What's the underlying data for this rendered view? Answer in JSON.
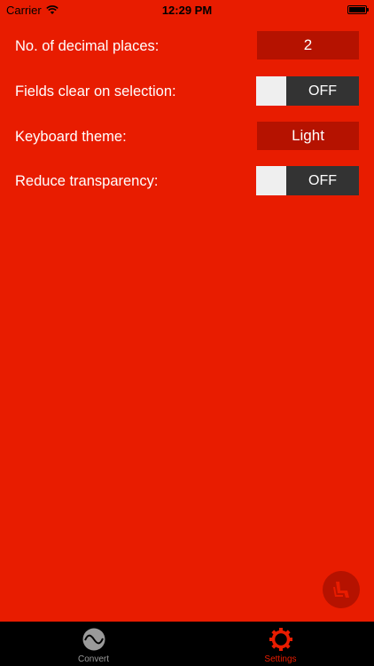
{
  "status_bar": {
    "carrier": "Carrier",
    "time": "12:29 PM"
  },
  "settings": {
    "decimal_places": {
      "label": "No. of decimal places:",
      "value": "2"
    },
    "fields_clear": {
      "label": "Fields clear on selection:",
      "state": "OFF"
    },
    "keyboard_theme": {
      "label": "Keyboard theme:",
      "value": "Light"
    },
    "reduce_transparency": {
      "label": "Reduce transparency:",
      "state": "OFF"
    }
  },
  "tab_bar": {
    "tabs": [
      {
        "label": "Convert",
        "icon": "convert-icon",
        "active": false,
        "color": "#9a9a9a"
      },
      {
        "label": "Settings",
        "icon": "gear-icon",
        "active": true,
        "color": "#e81c00"
      }
    ]
  },
  "colors": {
    "background": "#e81c00",
    "value_box": "#b51200",
    "toggle_off": "#333333",
    "toggle_knob": "#efefef"
  },
  "fab": {
    "icon": "seat-icon"
  }
}
